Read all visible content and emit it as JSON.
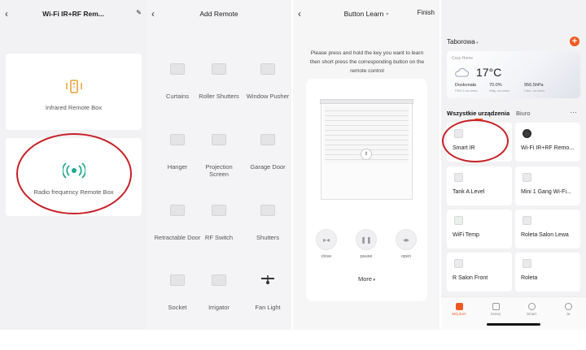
{
  "panel1": {
    "title": "Wi-Fi IR+RF Rem...",
    "cards": [
      {
        "label": "Infrared Remote Box"
      },
      {
        "label": "Radio frequency Remote Box"
      }
    ],
    "colors": {
      "ir": "#e8a33d",
      "rf": "#1fa98e",
      "annotation": "#c72026"
    }
  },
  "panel2": {
    "title": "Add Remote",
    "items": [
      {
        "label": "Curtains"
      },
      {
        "label": "Roller Shutters"
      },
      {
        "label": "Window Pusher"
      },
      {
        "label": "Hanger"
      },
      {
        "label": "Projection Screen"
      },
      {
        "label": "Garage Door"
      },
      {
        "label": "Retractable Door"
      },
      {
        "label": "RF Switch"
      },
      {
        "label": "Shutters"
      },
      {
        "label": "Socket"
      },
      {
        "label": "Irrigator"
      },
      {
        "label": "Fan Light"
      }
    ]
  },
  "panel3": {
    "title": "Button Learn",
    "finish": "Finish",
    "instruction": "Please press and hold the key you want to learn then short press the corresponding button on the remote control",
    "controls": [
      {
        "label": "close",
        "icon": "close-arrows-icon"
      },
      {
        "label": "pause",
        "icon": "pause-icon"
      },
      {
        "label": "open",
        "icon": "open-arrows-icon"
      }
    ],
    "more": "More"
  },
  "panel4": {
    "home": "Taborowa",
    "weather": {
      "location": "Cozy Home",
      "temp": "17°C",
      "condition": "Doskonała",
      "condition_sub": "PM2.5 na zewn.",
      "humidity": "70.0%",
      "humidity_sub": "Wilg. na zewn.",
      "pressure": "956.5hPa",
      "pressure_sub": "Ciśn. na zewn."
    },
    "tabs": [
      {
        "label": "Wszystkie urządzenia"
      },
      {
        "label": "Biuro"
      }
    ],
    "devices": [
      {
        "name": "Smart IR"
      },
      {
        "name": "Wi-Fi IR+RF Remo..."
      },
      {
        "name": "Tank A Level"
      },
      {
        "name": "Mini 1 Gang Wi-Fi..."
      },
      {
        "name": "WiFi Temp"
      },
      {
        "name": "Roleta Salon Lewa"
      },
      {
        "name": "R Salon Front"
      },
      {
        "name": "Roleta"
      }
    ],
    "bottom_tabs": [
      {
        "label": "Mój dom"
      },
      {
        "label": "Sceny"
      },
      {
        "label": "Smart"
      },
      {
        "label": "Ja"
      }
    ],
    "accent": "#f05a22"
  }
}
